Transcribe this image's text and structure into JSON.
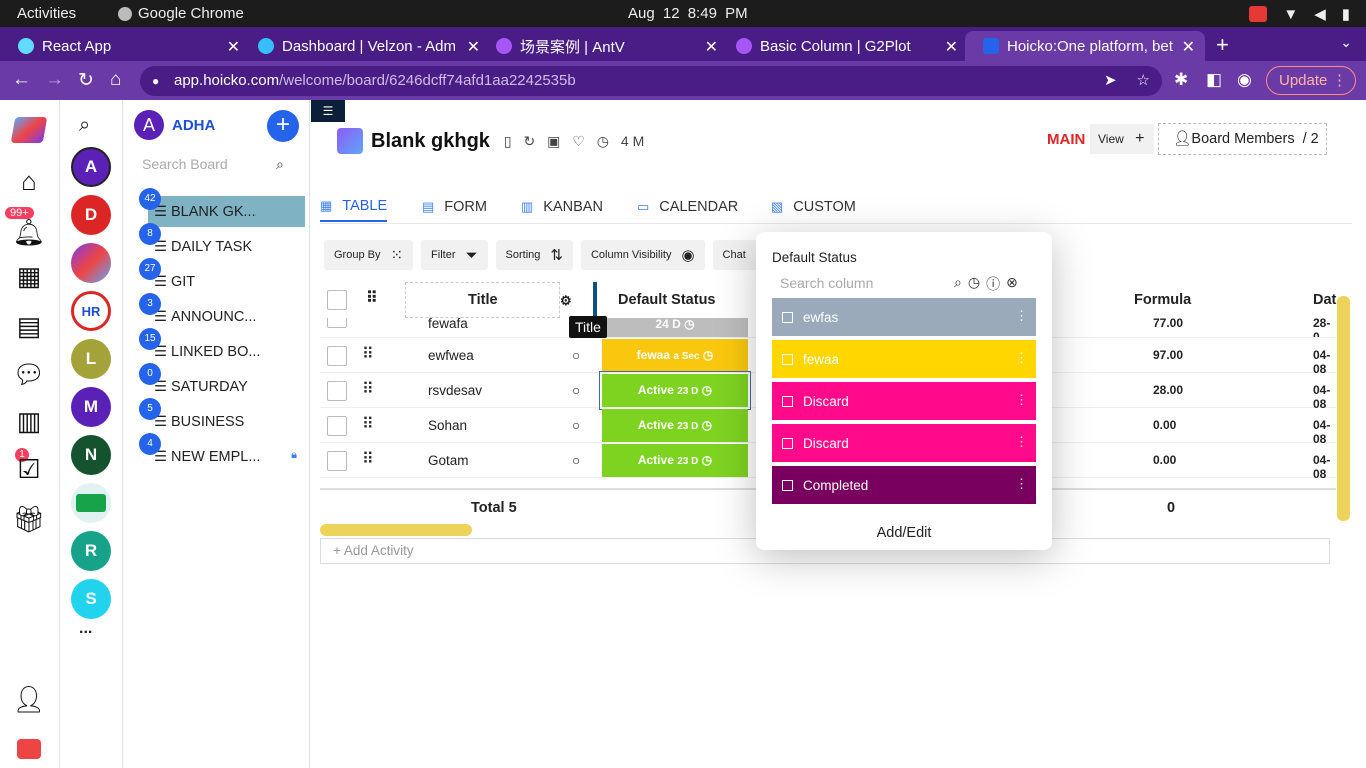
{
  "system": {
    "activities": "Activities",
    "app_name": "Google Chrome",
    "date": "Aug 12",
    "time": "8:49 PM"
  },
  "browser": {
    "tabs": [
      {
        "label": "React App"
      },
      {
        "label": "Dashboard | Velzon - Adm"
      },
      {
        "label": "场景案例 | AntV"
      },
      {
        "label": "Basic Column | G2Plot"
      },
      {
        "label": "Hoicko:One platform, bet"
      }
    ],
    "url_host": "app.hoicko.com",
    "url_path": "/welcome/board/6246dcff74afd1aa2242535b",
    "update_label": "Update"
  },
  "rail": {
    "notif_badge": "99+",
    "task_badge": "1"
  },
  "workspaces": [
    {
      "letter": "A",
      "color": "#5b21b6"
    },
    {
      "letter": "D",
      "color": "#dc2626"
    },
    {
      "letter": "",
      "color": "#ffffff"
    },
    {
      "letter": "",
      "color": "#ffffff"
    },
    {
      "letter": "L",
      "color": "#a3a33a"
    },
    {
      "letter": "M",
      "color": "#5b21b6"
    },
    {
      "letter": "N",
      "color": "#14532d"
    },
    {
      "letter": "",
      "color": "#ffffff"
    },
    {
      "letter": "R",
      "color": "#16a38a"
    },
    {
      "letter": "S",
      "color": "#22d3ee"
    }
  ],
  "workspace_more": "...",
  "boards_panel": {
    "user_letter": "A",
    "user_name": "ADHA",
    "search_placeholder": "Search Board",
    "items": [
      {
        "count": "42",
        "label": "BLANK GK..."
      },
      {
        "count": "8",
        "label": "DAILY TASK"
      },
      {
        "count": "27",
        "label": "GIT"
      },
      {
        "count": "3",
        "label": "ANNOUNC..."
      },
      {
        "count": "15",
        "label": "LINKED BO..."
      },
      {
        "count": "0",
        "label": "SATURDAY"
      },
      {
        "count": "5",
        "label": "BUSINESS"
      },
      {
        "count": "4",
        "label": "NEW EMPL..."
      }
    ]
  },
  "board": {
    "title": "Blank gkhgk",
    "age": "4 M",
    "main_label": "MAIN",
    "view_label": "View",
    "members_label": "Board Members",
    "members_count": "/ 2"
  },
  "views": [
    "TABLE",
    "FORM",
    "KANBAN",
    "CALENDAR",
    "CUSTOM"
  ],
  "tools": [
    "Group By",
    "Filter",
    "Sorting",
    "Column Visibility",
    "Chat"
  ],
  "table": {
    "headers": {
      "title": "Title",
      "status": "Default Status",
      "formula": "Formula",
      "date": "Dat"
    },
    "partial_row": {
      "title": "fewafa",
      "status": "24 D",
      "formula": "77.00",
      "date": "28-0"
    },
    "rows": [
      {
        "title": "ewfwea",
        "status": "fewaa",
        "status_time": "a Sec",
        "status_color": "#f9c80e",
        "formula": "97.00",
        "date": "04-08"
      },
      {
        "title": "rsvdesav",
        "status": "Active",
        "status_time": "23 D",
        "status_color": "#7ed321",
        "formula": "28.00",
        "date": "04-08"
      },
      {
        "title": "Sohan",
        "status": "Active",
        "status_time": "23 D",
        "status_color": "#7ed321",
        "formula": "0.00",
        "date": "04-08"
      },
      {
        "title": "Gotam",
        "status": "Active",
        "status_time": "23 D",
        "status_color": "#7ed321",
        "formula": "0.00",
        "date": "04-08"
      }
    ],
    "total_label": "Total 5",
    "total_formula": "0",
    "add_activity": "+ Add Activity"
  },
  "tooltip": "Title",
  "status_popup": {
    "title": "Default Status",
    "search_placeholder": "Search column",
    "options": [
      {
        "label": "ewfas",
        "color": "#9aaabb"
      },
      {
        "label": "fewaa",
        "color": "#ffd600"
      },
      {
        "label": "Discard",
        "color": "#ff0a8a"
      },
      {
        "label": "Discard",
        "color": "#ff0a8a"
      },
      {
        "label": "Completed",
        "color": "#7a0060"
      }
    ],
    "add_edit": "Add/Edit"
  }
}
